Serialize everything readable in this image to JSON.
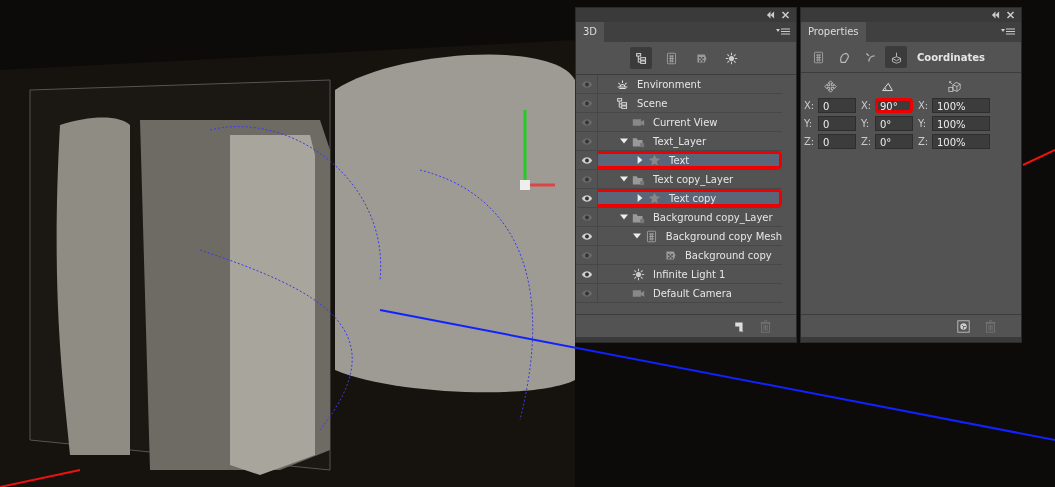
{
  "panel_3d": {
    "tab": "3D",
    "filter_buttons": [
      {
        "kind": "scene",
        "selected": true
      },
      {
        "kind": "mesh",
        "selected": false
      },
      {
        "kind": "material",
        "selected": false
      },
      {
        "kind": "light",
        "selected": false
      }
    ],
    "items": [
      {
        "label": "Environment",
        "kind": "environment",
        "visible": false,
        "selected": false,
        "highlighted": false
      },
      {
        "label": "Scene",
        "kind": "scene",
        "visible": false,
        "selected": false,
        "highlighted": false,
        "children": [
          {
            "label": "Current View",
            "kind": "camera",
            "visible": false,
            "selected": false,
            "highlighted": false
          },
          {
            "label": "Text_Layer",
            "kind": "folder",
            "visible": false,
            "selected": false,
            "highlighted": false,
            "expanded": true,
            "children": [
              {
                "label": "Text",
                "kind": "object",
                "visible": true,
                "selected": true,
                "highlighted": true,
                "expanded": false
              }
            ]
          },
          {
            "label": "Text copy_Layer",
            "kind": "folder",
            "visible": false,
            "selected": false,
            "highlighted": false,
            "expanded": true,
            "children": [
              {
                "label": "Text copy",
                "kind": "object",
                "visible": true,
                "selected": true,
                "highlighted": true,
                "expanded": false
              }
            ]
          },
          {
            "label": "Background copy_Layer",
            "kind": "folder",
            "visible": false,
            "selected": false,
            "highlighted": false,
            "expanded": true,
            "children": [
              {
                "label": "Background copy Mesh",
                "kind": "mesh",
                "visible": true,
                "selected": false,
                "highlighted": false,
                "expanded": true,
                "children": [
                  {
                    "label": "Background copy",
                    "kind": "material",
                    "visible": false,
                    "selected": false,
                    "highlighted": false
                  }
                ]
              }
            ]
          },
          {
            "label": "Infinite Light 1",
            "kind": "light",
            "visible": true,
            "selected": false,
            "highlighted": false
          },
          {
            "label": "Default Camera",
            "kind": "camera",
            "visible": false,
            "selected": false,
            "highlighted": false
          }
        ]
      }
    ]
  },
  "properties": {
    "tab": "Properties",
    "section_tabs": [
      {
        "kind": "mesh",
        "selected": false
      },
      {
        "kind": "deform",
        "selected": false
      },
      {
        "kind": "cap",
        "selected": false
      },
      {
        "kind": "coordinates",
        "selected": true
      }
    ],
    "section_title": "Coordinates",
    "columns": [
      {
        "kind": "position",
        "fields": [
          {
            "axis": "X:",
            "value": "0",
            "highlighted": false
          },
          {
            "axis": "Y:",
            "value": "0",
            "highlighted": false
          },
          {
            "axis": "Z:",
            "value": "0",
            "highlighted": false
          }
        ]
      },
      {
        "kind": "rotation",
        "fields": [
          {
            "axis": "X:",
            "value": "90°",
            "highlighted": true
          },
          {
            "axis": "Y:",
            "value": "0°",
            "highlighted": false
          },
          {
            "axis": "Z:",
            "value": "0°",
            "highlighted": false
          }
        ]
      },
      {
        "kind": "scale",
        "fields": [
          {
            "axis": "X:",
            "value": "100%",
            "highlighted": false
          },
          {
            "axis": "Y:",
            "value": "100%",
            "highlighted": false
          },
          {
            "axis": "Z:",
            "value": "100%",
            "highlighted": false
          }
        ]
      }
    ]
  }
}
